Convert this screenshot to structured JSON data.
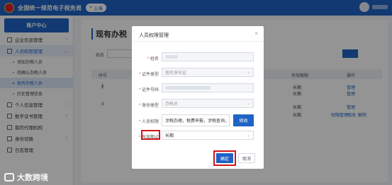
{
  "header": {
    "title": "全国统一规范电子税务局",
    "city": "上海",
    "city_icon": "location-pin-icon"
  },
  "sidebar": {
    "header": "账户中心",
    "items": [
      {
        "label": "企业信息管理",
        "icon": "building-icon"
      },
      {
        "label": "人员权限管理",
        "icon": "people-icon"
      },
      {
        "label": "个人信息管理",
        "icon": "person-icon"
      },
      {
        "label": "数字证书管理",
        "icon": "certificate-icon"
      },
      {
        "label": "我的代理机构",
        "icon": "agency-icon"
      },
      {
        "label": "身份切换",
        "icon": "switch-icon"
      },
      {
        "label": "日志管理",
        "icon": "log-icon"
      }
    ],
    "sub_items": [
      {
        "label": "添加办税人员"
      },
      {
        "label": "待确认办税人员"
      },
      {
        "label": "现有办税人员"
      },
      {
        "label": "历史管理信息"
      }
    ]
  },
  "main": {
    "title": "现有办税",
    "filter_label": "姓名",
    "columns": [
      "序号",
      "有效期限",
      "操作"
    ],
    "rows": [
      {
        "index": "1",
        "period": "长期",
        "action": "管理"
      },
      {
        "index": "2",
        "period": "长期",
        "action": "管理"
      },
      {
        "index": "3",
        "period": "长期",
        "action": "管理"
      },
      {
        "index": "4",
        "period": "长期",
        "actions": [
          "权限管理",
          "修改",
          "解除"
        ]
      }
    ]
  },
  "modal": {
    "title": "人员权限管理",
    "labels": {
      "name": "姓名",
      "id_type": "证件类型",
      "id_number": "证件号码",
      "identity_type": "身份类型",
      "permissions": "人员权限",
      "validity": "有效期止"
    },
    "values": {
      "id_type": "居民身份证",
      "identity_type": "办税员",
      "permissions": "涉税办理，税费申报，涉税查询，发票…",
      "validity": "长期"
    },
    "edit_button": "修改",
    "confirm_button": "确定",
    "cancel_button": "取消"
  },
  "watermark": "大数跨境"
}
